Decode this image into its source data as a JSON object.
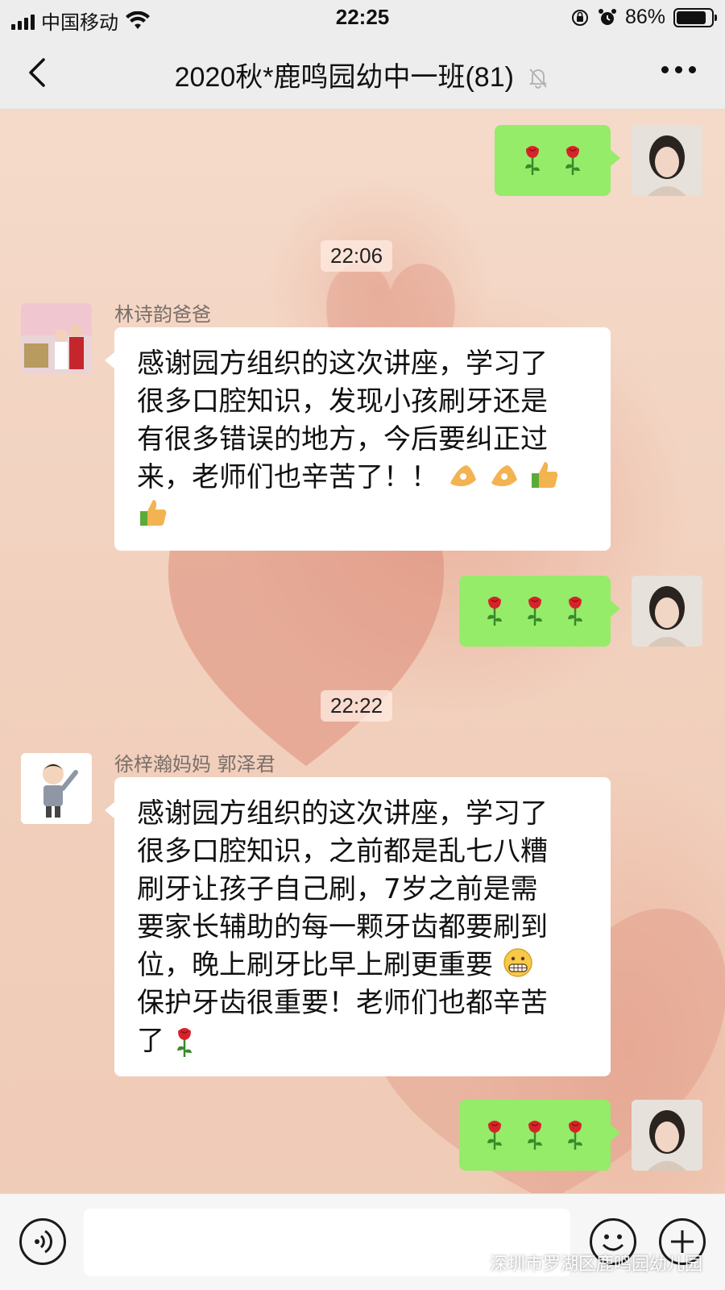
{
  "status_bar": {
    "carrier": "中国移动",
    "time": "22:25",
    "battery_percent": "86%",
    "battery_level": 0.86
  },
  "nav": {
    "title": "2020秋*鹿鸣园幼中一班(81)"
  },
  "messages": {
    "self_1": {
      "content": "rose rose"
    },
    "ts_1": "22:06",
    "lin": {
      "sender": "林诗韵爸爸",
      "line1": "感谢园方组织的这次讲座，学习了",
      "line2": "很多口腔知识，发现小孩刷牙还是",
      "line3": "有很多错误的地方，今后要纠正过",
      "line4": "来，老师们也辛苦了！！",
      "emojis": [
        "ok-hand",
        "ok-hand",
        "thumbs-up",
        "thumbs-up"
      ]
    },
    "self_2": {
      "content": "rose rose rose"
    },
    "ts_2": "22:22",
    "xu": {
      "sender": "徐梓瀚妈妈  郭泽君",
      "line1": "感谢园方组织的这次讲座，学习了",
      "line2": "很多口腔知识，之前都是乱七八糟",
      "line3": "刷牙让孩子自己刷，7岁之前是需",
      "line4": "要家长辅助的每一颗牙齿都要刷到",
      "line5": "位，晚上刷牙比早上刷更重要",
      "line6": "保护牙齿很重要！老师们也都辛苦",
      "line7": "了"
    },
    "self_3": {
      "content": "rose rose rose"
    }
  },
  "input": {
    "placeholder": ""
  },
  "watermark": "深圳市罗湖区鹿鸣园幼儿园",
  "colors": {
    "self_bubble": "#95ec69",
    "other_bubble": "#ffffff",
    "bar": "#ededed"
  }
}
